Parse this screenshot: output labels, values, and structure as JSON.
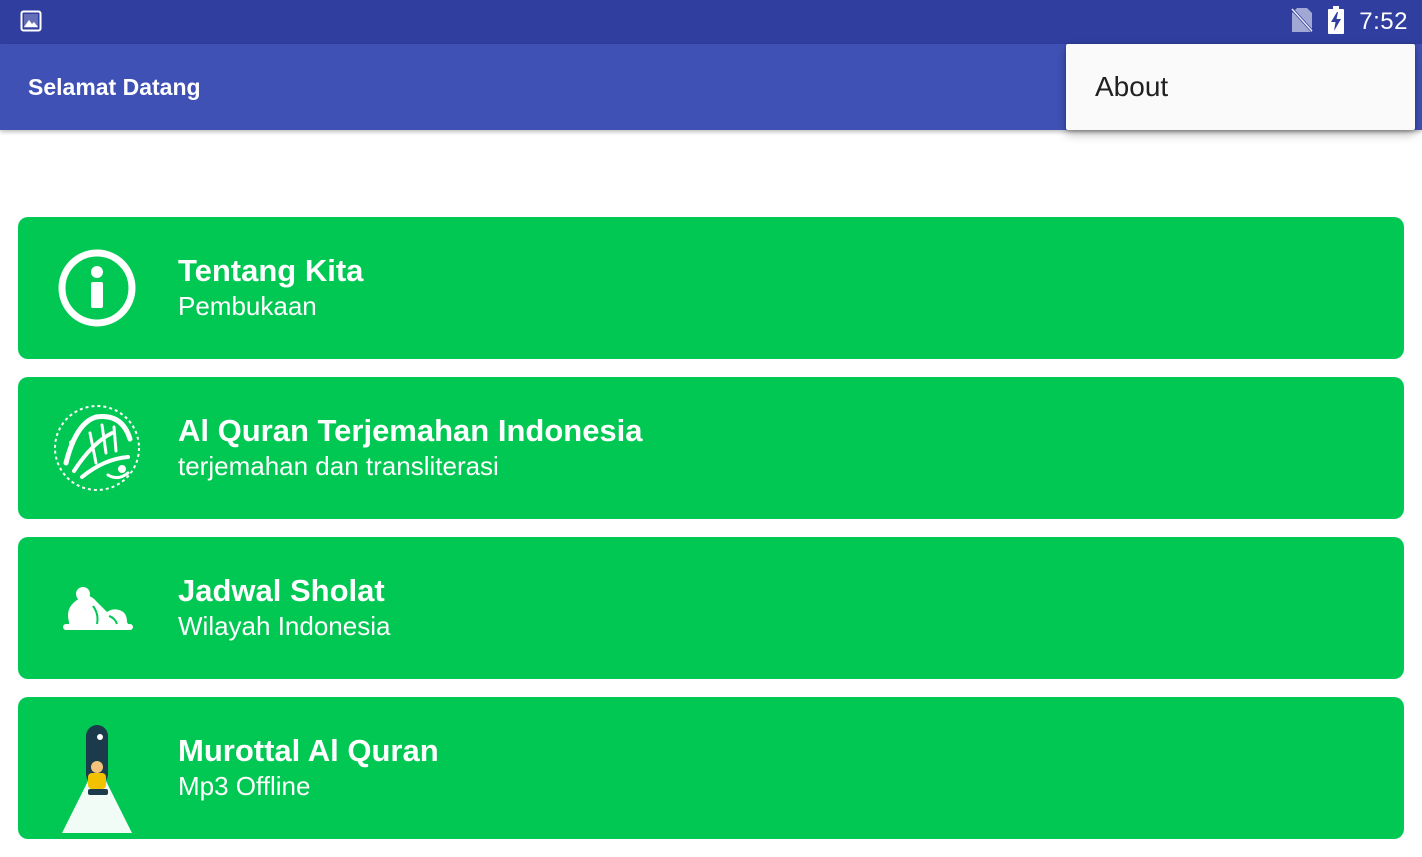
{
  "status_bar": {
    "time": "7:52",
    "left_icon": "image-notification-icon",
    "right_icons": [
      "no-sim-icon",
      "battery-charging-icon"
    ]
  },
  "app_bar": {
    "title": "Selamat Datang"
  },
  "overflow_menu": {
    "items": [
      {
        "label": "About"
      }
    ]
  },
  "cards": [
    {
      "title": "Tentang Kita",
      "subtitle": "Pembukaan",
      "icon": "info-icon"
    },
    {
      "title": "Al Quran Terjemahan Indonesia",
      "subtitle": "terjemahan dan transliterasi",
      "icon": "quran-calligraphy-icon"
    },
    {
      "title": "Jadwal Sholat",
      "subtitle": "Wilayah Indonesia",
      "icon": "prayer-icon"
    },
    {
      "title": "Murottal Al Quran",
      "subtitle": "Mp3 Offline",
      "icon": "murottal-icon"
    }
  ],
  "colors": {
    "status_bar": "#303f9f",
    "app_bar": "#3f51b5",
    "card": "#00c853",
    "menu": "#fafafa"
  }
}
